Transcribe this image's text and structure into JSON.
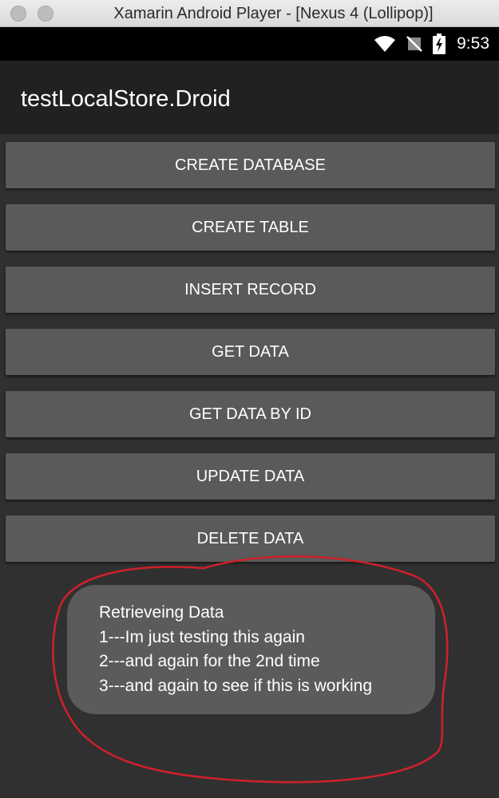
{
  "window": {
    "title": "Xamarin Android Player - [Nexus 4 (Lollipop)]"
  },
  "status_bar": {
    "time": "9:53",
    "icons": [
      "wifi-icon",
      "no-signal-icon",
      "battery-charging-icon"
    ]
  },
  "app": {
    "title": "testLocalStore.Droid"
  },
  "buttons": [
    {
      "label": "CREATE DATABASE"
    },
    {
      "label": "CREATE TABLE"
    },
    {
      "label": "INSERT RECORD"
    },
    {
      "label": "GET DATA"
    },
    {
      "label": "GET DATA BY ID"
    },
    {
      "label": "UPDATE DATA"
    },
    {
      "label": "DELETE DATA"
    }
  ],
  "toast": {
    "lines": [
      "Retrieveing Data",
      "1---Im just testing this again",
      "2---and again for the 2nd time",
      "3---and again to see if this is working"
    ]
  },
  "colors": {
    "button_bg": "#5a5a5a",
    "action_bar": "#212121",
    "annotation": "#d0202a"
  }
}
